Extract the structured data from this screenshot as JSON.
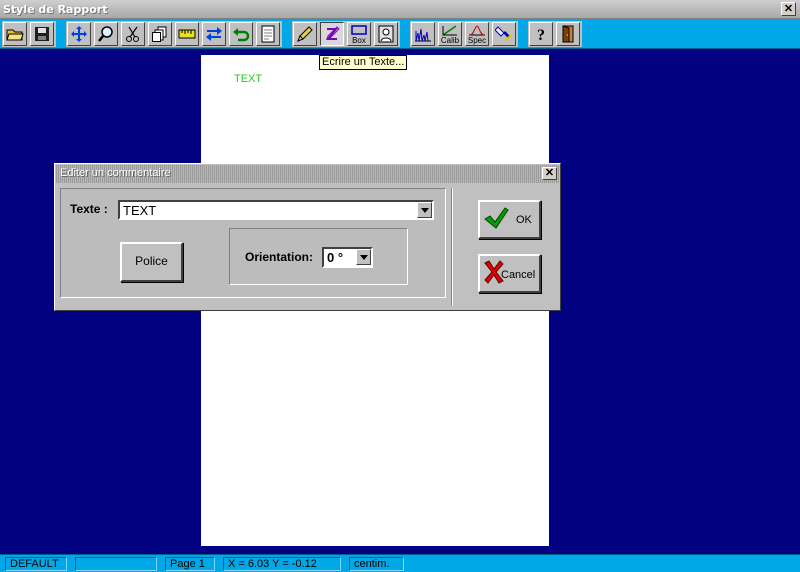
{
  "window": {
    "title": "Style de Rapport",
    "close_glyph": "✕"
  },
  "toolbar": {
    "buttons": [
      {
        "name": "open-folder-icon"
      },
      {
        "name": "save-icon"
      },
      {
        "name": "move-icon"
      },
      {
        "name": "zoom-icon"
      },
      {
        "name": "cut-icon"
      },
      {
        "name": "copy-icon"
      },
      {
        "name": "ruler-icon"
      },
      {
        "name": "arrows-icon"
      },
      {
        "name": "undo-icon"
      },
      {
        "name": "page-icon"
      },
      {
        "name": "pencil-icon"
      },
      {
        "name": "text-tool-icon"
      },
      {
        "name": "box-icon",
        "label": "Box"
      },
      {
        "name": "portrait-icon"
      },
      {
        "name": "peaks-icon"
      },
      {
        "name": "calib-icon",
        "label": "Calib"
      },
      {
        "name": "spec-icon",
        "label": "Spec"
      },
      {
        "name": "flashlight-icon"
      },
      {
        "name": "help-icon",
        "label": "?"
      },
      {
        "name": "exit-door-icon"
      }
    ]
  },
  "tooltip": "Ecrire un Texte...",
  "page": {
    "text": "TEXT",
    "text_color": "#22cc22"
  },
  "dialog": {
    "title": "Editer un commentaire",
    "texte_label": "Texte :",
    "texte_value": "TEXT",
    "police_label": "Police",
    "orientation_label": "Orientation:",
    "orientation_value": "0 °",
    "ok_label": "OK",
    "cancel_label": "Cancel"
  },
  "statusbar": {
    "style": "DEFAULT",
    "blank": "",
    "page": "Page 1",
    "coords": "X = 6.03 Y = -0.12",
    "units": "centim."
  }
}
